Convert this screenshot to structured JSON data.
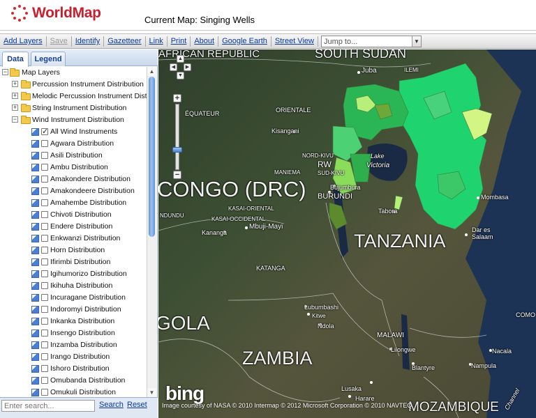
{
  "app": {
    "logo_text": "WorldMap",
    "current_map": "Current Map: Singing Wells",
    "colors": {
      "brand": "#c91f2e",
      "link": "#0b3aa0",
      "panel_border": "#99b0cc"
    }
  },
  "toolbar": {
    "add_layers": "Add Layers",
    "save": "Save",
    "identify": "Identify",
    "gazetteer": "Gazetteer",
    "link": "Link",
    "print": "Print",
    "about": "About",
    "google_earth": "Google Earth",
    "street_view": "Street View",
    "jump_placeholder": "Jump to..."
  },
  "tabs": {
    "data": "Data",
    "legend": "Legend"
  },
  "tree": {
    "root": "Map Layers",
    "groups": [
      {
        "label": "Percussion Instrument Distribution",
        "expanded": false
      },
      {
        "label": "Melodic Percussion Instrument Distrib",
        "expanded": false
      },
      {
        "label": "String Instrument Distribution",
        "expanded": false
      },
      {
        "label": "Wind Instrument Distribution",
        "expanded": true
      }
    ],
    "layers": [
      {
        "label": "All Wind Instruments",
        "checked": true
      },
      {
        "label": "Agwara Distribution",
        "checked": false
      },
      {
        "label": "Asili Distribution",
        "checked": false
      },
      {
        "label": "Ambu Distribution",
        "checked": false
      },
      {
        "label": "Amakondere Distribution",
        "checked": false
      },
      {
        "label": "Amakondeere Distribution",
        "checked": false
      },
      {
        "label": "Amahembe Distribution",
        "checked": false
      },
      {
        "label": "Chivoti Distribution",
        "checked": false
      },
      {
        "label": "Endere Distribution",
        "checked": false
      },
      {
        "label": "Enkwanzi Distribution",
        "checked": false
      },
      {
        "label": "Horn Distribution",
        "checked": false
      },
      {
        "label": "Ifirimbi Distribution",
        "checked": false
      },
      {
        "label": "Igihumorizo Distribution",
        "checked": false
      },
      {
        "label": "Ikihuha Distribution",
        "checked": false
      },
      {
        "label": "Incuragane Distribution",
        "checked": false
      },
      {
        "label": "Indoromyi Distribution",
        "checked": false
      },
      {
        "label": "Inkanka Distribution",
        "checked": false
      },
      {
        "label": "Insengo Distribution",
        "checked": false
      },
      {
        "label": "Inzamba Distribution",
        "checked": false
      },
      {
        "label": "Irango Distribution",
        "checked": false
      },
      {
        "label": "Ishoro Distribution",
        "checked": false
      },
      {
        "label": "Omubanda Distribution",
        "checked": false
      },
      {
        "label": "Omukuli Distribution",
        "checked": false
      }
    ]
  },
  "search": {
    "placeholder": "Enter search...",
    "search_label": "Search",
    "reset_label": "Reset"
  },
  "map": {
    "labels": [
      {
        "text": "AFRICAN REPUBLIC",
        "size": "big"
      },
      {
        "text": "SOUTH SUDAN",
        "size": "big"
      },
      {
        "text": "CONGO (DRC)",
        "size": "huge"
      },
      {
        "text": "TANZANIA",
        "size": "huge"
      },
      {
        "text": "GOLA",
        "size": "huge"
      },
      {
        "text": "ZAMBIA",
        "size": "huge"
      },
      {
        "text": "MOZAMBIQUE",
        "size": "big"
      },
      {
        "text": "Juba",
        "size": "small"
      },
      {
        "text": "ILEMI",
        "size": "tiny"
      },
      {
        "text": "ORIENTALE",
        "size": "tiny"
      },
      {
        "text": "ÉQUATEUR",
        "size": "tiny"
      },
      {
        "text": "Kisangani",
        "size": "small"
      },
      {
        "text": "NORD-KIVU",
        "size": "tiny"
      },
      {
        "text": "RW",
        "size": "small"
      },
      {
        "text": "MANIEMA",
        "size": "tiny"
      },
      {
        "text": "SUD-KIVU",
        "size": "tiny"
      },
      {
        "text": "Lake",
        "size": "small"
      },
      {
        "text": "Victoria",
        "size": "small"
      },
      {
        "text": "Bujumbura",
        "size": "small"
      },
      {
        "text": "BURUNDI",
        "size": "small"
      },
      {
        "text": "Tabora",
        "size": "small"
      },
      {
        "text": "Mombasa",
        "size": "small"
      },
      {
        "text": "Dar es",
        "size": "small"
      },
      {
        "text": "Salaam",
        "size": "small"
      },
      {
        "text": "KASAI-ORIENTAL",
        "size": "tiny"
      },
      {
        "text": "KASAI-OCCIDENTAL",
        "size": "tiny"
      },
      {
        "text": "Mbuji-Mayi",
        "size": "small"
      },
      {
        "text": "Kananga",
        "size": "small"
      },
      {
        "text": "NDUNDU",
        "size": "tiny"
      },
      {
        "text": "KATANGA",
        "size": "tiny"
      },
      {
        "text": "Lubumbashi",
        "size": "small"
      },
      {
        "text": "Ndola",
        "size": "small"
      },
      {
        "text": "Kitwe",
        "size": "small"
      },
      {
        "text": "MALAWI",
        "size": "small"
      },
      {
        "text": "Lilongwe",
        "size": "small"
      },
      {
        "text": "Blantyre",
        "size": "small"
      },
      {
        "text": "Nacala",
        "size": "small"
      },
      {
        "text": "Nampula",
        "size": "small"
      },
      {
        "text": "Lusaka",
        "size": "small"
      },
      {
        "text": "Harare",
        "size": "small"
      },
      {
        "text": "COMO",
        "size": "tiny"
      },
      {
        "text": "Channel",
        "size": "tiny"
      }
    ],
    "bing_logo": "bing",
    "attribution": "Image courtesy of NASA © 2010 Intermap © 2012 Microsoft Corporation © 2010 NAVTEQ",
    "colors": {
      "region_bright": "#1fd36e",
      "region_mid": "#2bb655",
      "region_light": "#b6f07a",
      "region_dark": "#5c8a2c"
    }
  }
}
